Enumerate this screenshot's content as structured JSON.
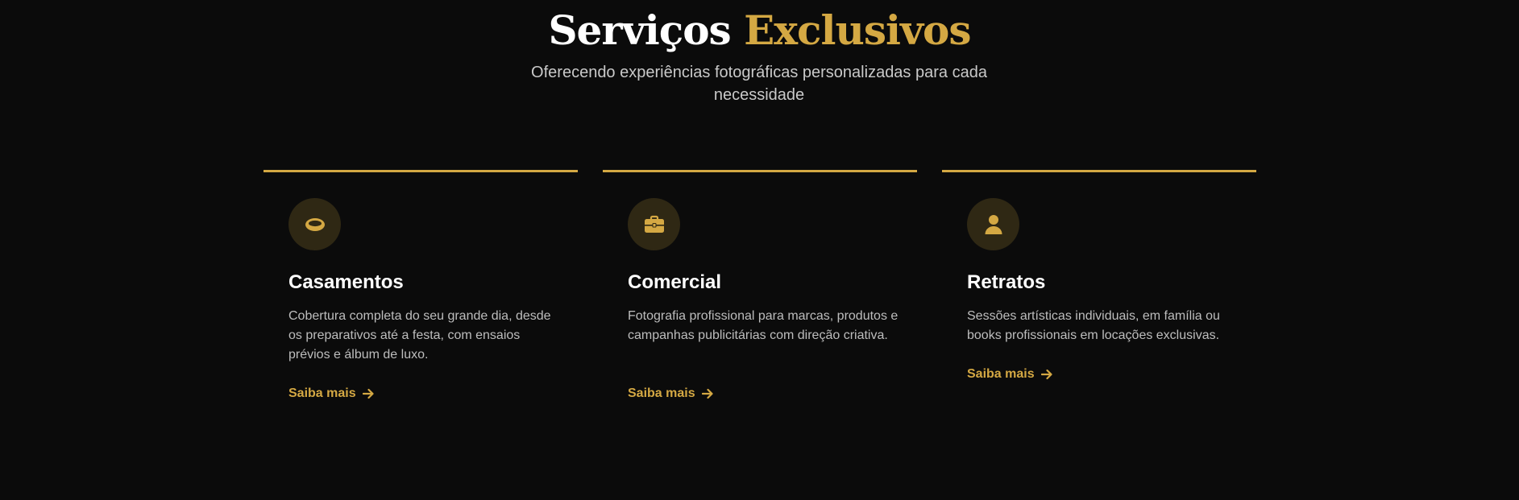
{
  "header": {
    "title_main": "Serviços",
    "title_accent": "Exclusivos",
    "subtitle": "Oferecendo experiências fotográficas personalizadas para cada necessidade"
  },
  "colors": {
    "background": "#0b0b0b",
    "accent": "#d4a843",
    "icon_bg": "#2f2814",
    "text_primary": "#ffffff",
    "text_secondary": "#bdbdbd"
  },
  "services": [
    {
      "icon": "ring-icon",
      "title": "Casamentos",
      "description": "Cobertura completa do seu grande dia, desde os preparativos até a festa, com ensaios prévios e álbum de luxo.",
      "link_label": "Saiba mais"
    },
    {
      "icon": "briefcase-icon",
      "title": "Comercial",
      "description": "Fotografia profissional para marcas, produtos e campanhas publicitárias com direção criativa.",
      "link_label": "Saiba mais"
    },
    {
      "icon": "user-icon",
      "title": "Retratos",
      "description": "Sessões artísticas individuais, em família ou books profissionais em locações exclusivas.",
      "link_label": "Saiba mais"
    }
  ]
}
